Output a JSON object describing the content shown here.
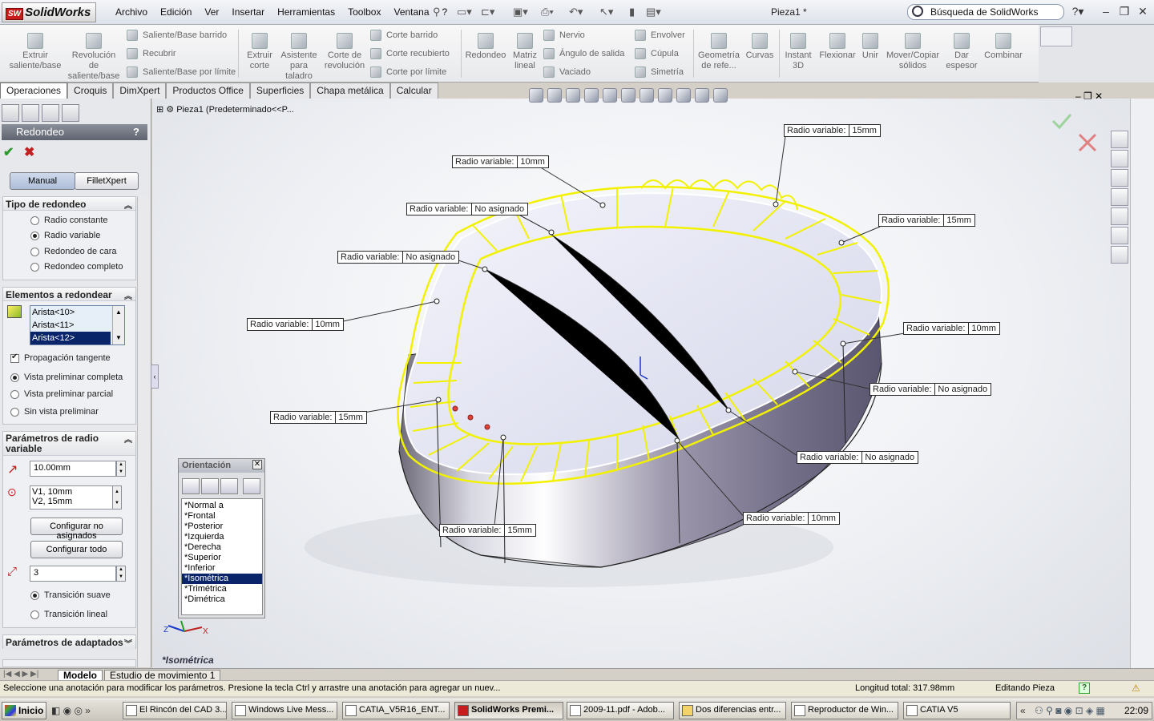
{
  "app": {
    "logo": "SolidWorks",
    "logo_mark": "SW",
    "document_title": "Pieza1 *"
  },
  "menu": [
    "Archivo",
    "Edición",
    "Ver",
    "Insertar",
    "Herramientas",
    "Toolbox",
    "Ventana",
    "?"
  ],
  "search": {
    "text": "Búsqueda de SolidWorks"
  },
  "command_manager": {
    "big_buttons": [
      "Extruir saliente/base",
      "Revolución de saliente/base",
      "Extruir corte",
      "Asistente para taladro",
      "Corte de revolución",
      "Redondeo",
      "Matriz lineal",
      "Geometría de refe...",
      "Curvas",
      "Instant 3D",
      "Flexionar",
      "Unir",
      "Mover/Copiar sólidos",
      "Dar espesor",
      "Combinar"
    ],
    "small_buttons": [
      "Saliente/Base barrido",
      "Recubrir",
      "Saliente/Base por límite",
      "Corte barrido",
      "Corte recubierto",
      "Corte por límite",
      "Nervio",
      "Ángulo de salida",
      "Vaciado",
      "Envolver",
      "Cúpula",
      "Simetría"
    ]
  },
  "tabs": [
    "Operaciones",
    "Croquis",
    "DimXpert",
    "Productos Office",
    "Superficies",
    "Chapa metálica",
    "Calcular"
  ],
  "property_manager": {
    "title": "Redondeo",
    "help": "?",
    "mode_buttons": [
      "Manual",
      "FilletXpert"
    ],
    "fillet_type": {
      "title": "Tipo de redondeo",
      "options": [
        "Radio constante",
        "Radio variable",
        "Redondeo de cara",
        "Redondeo completo"
      ],
      "selected": 1
    },
    "items": {
      "title": "Elementos a redondear",
      "list": [
        "Arista<10>",
        "Arista<11>",
        "Arista<12>"
      ],
      "tangent_propagation": "Propagación tangente",
      "preview_options": [
        "Vista preliminar completa",
        "Vista preliminar parcial",
        "Sin vista preliminar"
      ],
      "preview_selected": 0
    },
    "variable_params": {
      "title": "Parámetros de radio variable",
      "radius": "10.00mm",
      "vertices": [
        "V1, 10mm",
        "V2, 15mm"
      ],
      "btn_unassigned": "Configurar no asignados",
      "btn_all": "Configurar todo",
      "instances": "3",
      "transitions": [
        "Transición suave",
        "Transición lineal"
      ],
      "transition_selected": 0
    },
    "setback": {
      "title": "Parámetros de adaptados"
    }
  },
  "tree": {
    "root": "Pieza1  (Predeterminado<<P..."
  },
  "callouts": [
    {
      "key": "Radio variable:",
      "value": "15mm"
    },
    {
      "key": "Radio variable:",
      "value": "10mm"
    },
    {
      "key": "Radio variable:",
      "value": "No asignado"
    },
    {
      "key": "Radio variable:",
      "value": "15mm"
    },
    {
      "key": "Radio variable:",
      "value": "No asignado"
    },
    {
      "key": "Radio variable:",
      "value": "10mm"
    },
    {
      "key": "Radio variable:",
      "value": "10mm"
    },
    {
      "key": "Radio variable:",
      "value": "No asignado"
    },
    {
      "key": "Radio variable:",
      "value": "15mm"
    },
    {
      "key": "Radio variable:",
      "value": "No asignado"
    },
    {
      "key": "Radio variable:",
      "value": "10mm"
    },
    {
      "key": "Radio variable:",
      "value": "15mm"
    }
  ],
  "orientation": {
    "title": "Orientación",
    "views": [
      "*Normal a",
      "*Frontal",
      "*Posterior",
      "*Izquierda",
      "*Derecha",
      "*Superior",
      "*Inferior",
      "*Isométrica",
      "*Trimétrica",
      "*Dimétrica"
    ],
    "selected": 7
  },
  "current_view": "*Isométrica",
  "bottom_tabs": [
    "Modelo",
    "Estudio de movimiento 1"
  ],
  "status": {
    "message": "Seleccione una anotación para modificar los parámetros. Presione la tecla Ctrl y arrastre una anotación para agregar un nuev...",
    "length": "Longitud total:  317.98mm",
    "mode": "Editando Pieza"
  },
  "taskbar": {
    "start": "Inicio",
    "items": [
      "El Rincón del CAD 3...",
      "Windows Live Mess...",
      "CATIA_V5R16_ENT...",
      "SolidWorks Premi...",
      "2009-11.pdf - Adob...",
      "Dos diferencias entr...",
      "Reproductor de Win...",
      "CATIA V5"
    ],
    "active": 3,
    "clock": "22:09"
  },
  "colors": {
    "accent_selection": "#0a246a",
    "preview_yellow": "#f2f200",
    "pm_header": "#6b717c"
  }
}
